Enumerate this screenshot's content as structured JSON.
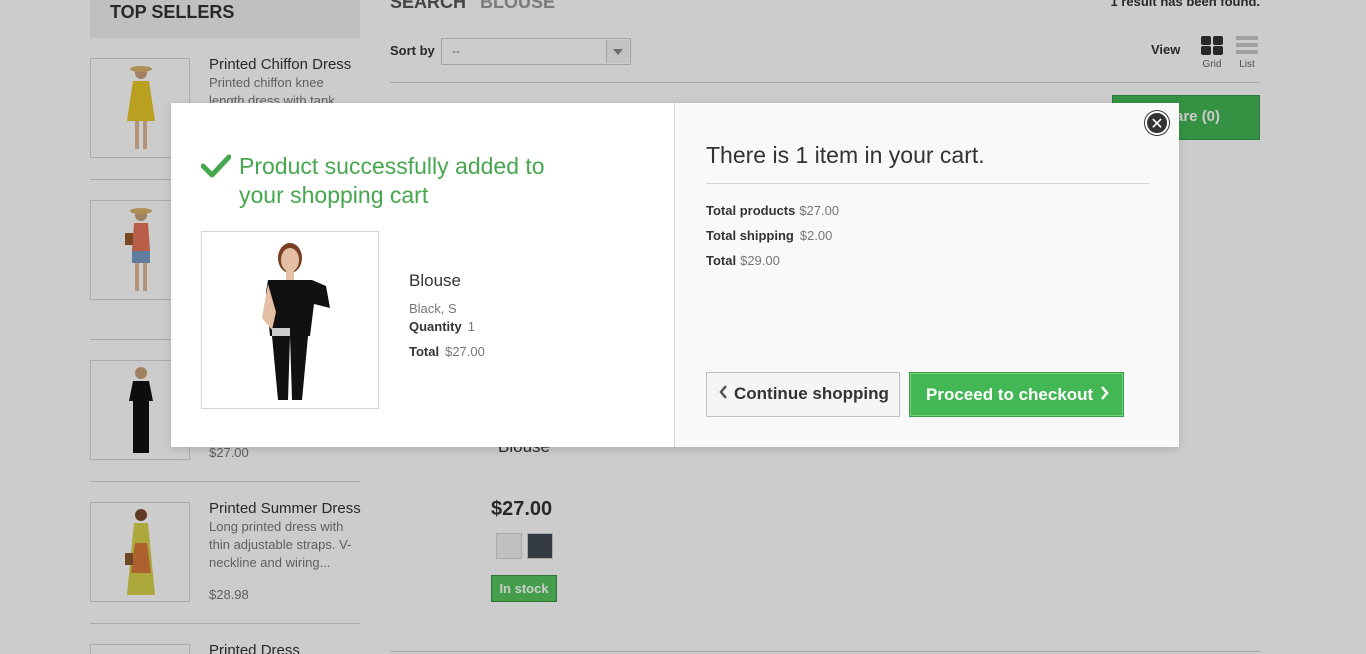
{
  "sidebar": {
    "title": "TOP SELLERS",
    "items": [
      {
        "name": "Printed Chiffon Dress",
        "desc": "Printed chiffon knee length dress with tank",
        "price": ""
      },
      {
        "name": "",
        "desc": "",
        "price": ""
      },
      {
        "name": "",
        "desc": "",
        "price": "$27.00"
      },
      {
        "name": "Printed Summer Dress",
        "desc": "Long printed dress with thin adjustable straps. V-neckline and wiring...",
        "price": "$28.98"
      },
      {
        "name": "Printed Dress",
        "desc": "",
        "price": ""
      }
    ]
  },
  "main": {
    "heading": "SEARCH",
    "query": "BLOUSE",
    "result_count": "1 result has been found.",
    "sort_label": "Sort by",
    "sort_value": "--",
    "view_label": "View",
    "view_grid": "Grid",
    "view_list": "List",
    "compare_label": "are (0)",
    "product_name": "Blouse",
    "product_price": "$27.00",
    "swatch_colors": [
      "#f1f1f1",
      "#434a54"
    ],
    "stock": "In stock"
  },
  "modal": {
    "success_message": "Product successfully added to your shopping cart",
    "product": {
      "title": "Blouse",
      "attributes": "Black, S",
      "quantity_label": "Quantity",
      "quantity": "1",
      "total_label": "Total",
      "total": "$27.00"
    },
    "cart": {
      "count_text": "There is 1 item in your cart.",
      "total_products_label": "Total products",
      "total_products": "$27.00",
      "total_shipping_label": "Total shipping",
      "total_shipping": "$2.00",
      "total_label": "Total",
      "total": "$29.00"
    },
    "continue_label": "Continue shopping",
    "checkout_label": "Proceed to checkout"
  },
  "colors": {
    "success_green": "#46a74e",
    "button_green": "#43b754",
    "overlay": "rgba(0,0,0,0.2)"
  },
  "icons": [
    "check-icon",
    "close-icon",
    "chevron-left-icon",
    "chevron-right-icon",
    "grid-view-icon",
    "list-view-icon",
    "dropdown-arrow-icon"
  ]
}
